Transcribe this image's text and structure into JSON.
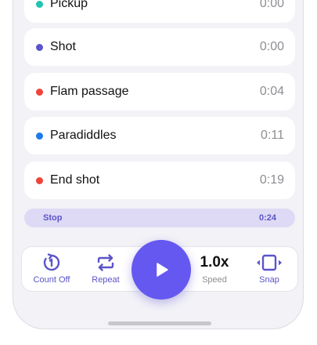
{
  "colors": {
    "accent": "#6558f0",
    "teal": "#21c4b0",
    "purple": "#5b54c9",
    "red": "#f0443a",
    "blue": "#1f7ae8"
  },
  "segments": [
    {
      "label": "Pickup",
      "time": "0:00",
      "dot_color": "#21c4b0"
    },
    {
      "label": "Shot",
      "time": "0:00",
      "dot_color": "#5b54c9"
    },
    {
      "label": "Flam passage",
      "time": "0:04",
      "dot_color": "#f0443a"
    },
    {
      "label": "Paradiddles",
      "time": "0:11",
      "dot_color": "#1f7ae8"
    },
    {
      "label": "End shot",
      "time": "0:19",
      "dot_color": "#f0443a"
    }
  ],
  "stop_bar": {
    "label": "Stop",
    "time": "0:24"
  },
  "toolbar": {
    "count_off": {
      "label": "Count Off",
      "icon": "count-off-icon"
    },
    "repeat": {
      "label": "Repeat",
      "icon": "repeat-icon"
    },
    "play": {
      "icon": "play-icon"
    },
    "speed": {
      "value": "1.0x",
      "label": "Speed"
    },
    "snap": {
      "label": "Snap",
      "icon": "snap-icon"
    }
  }
}
